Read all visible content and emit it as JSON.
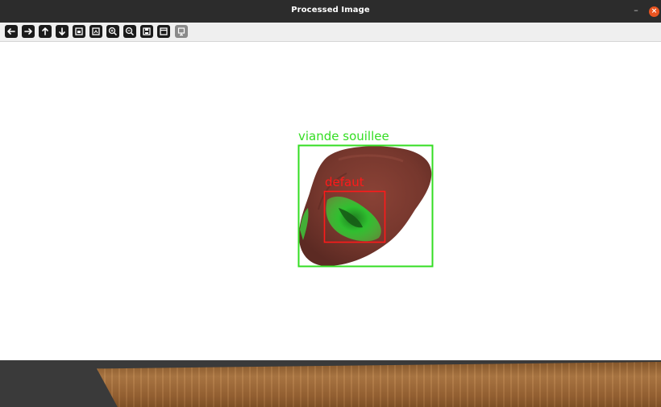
{
  "window": {
    "title": "Processed Image",
    "minimize_label": "–",
    "close_label": "×",
    "close_color": "#e95420"
  },
  "toolbar": {
    "tools": [
      {
        "icon": "arrow-left-icon"
      },
      {
        "icon": "arrow-right-icon"
      },
      {
        "icon": "arrow-up-icon"
      },
      {
        "icon": "arrow-down-icon"
      },
      {
        "icon": "zoom-fit-icon"
      },
      {
        "icon": "zoom-original-icon"
      },
      {
        "icon": "zoom-in-icon"
      },
      {
        "icon": "zoom-out-icon"
      },
      {
        "icon": "save-icon"
      },
      {
        "icon": "properties-icon"
      },
      {
        "icon": "settings-disabled-icon"
      }
    ]
  },
  "image": {
    "detections": [
      {
        "label": "viande souillee",
        "color": "#33dd22"
      },
      {
        "label": "defaut",
        "color": "#ff1a1a"
      }
    ],
    "meat_color": "#7a3a30",
    "defect_color": "#2ecc40"
  }
}
